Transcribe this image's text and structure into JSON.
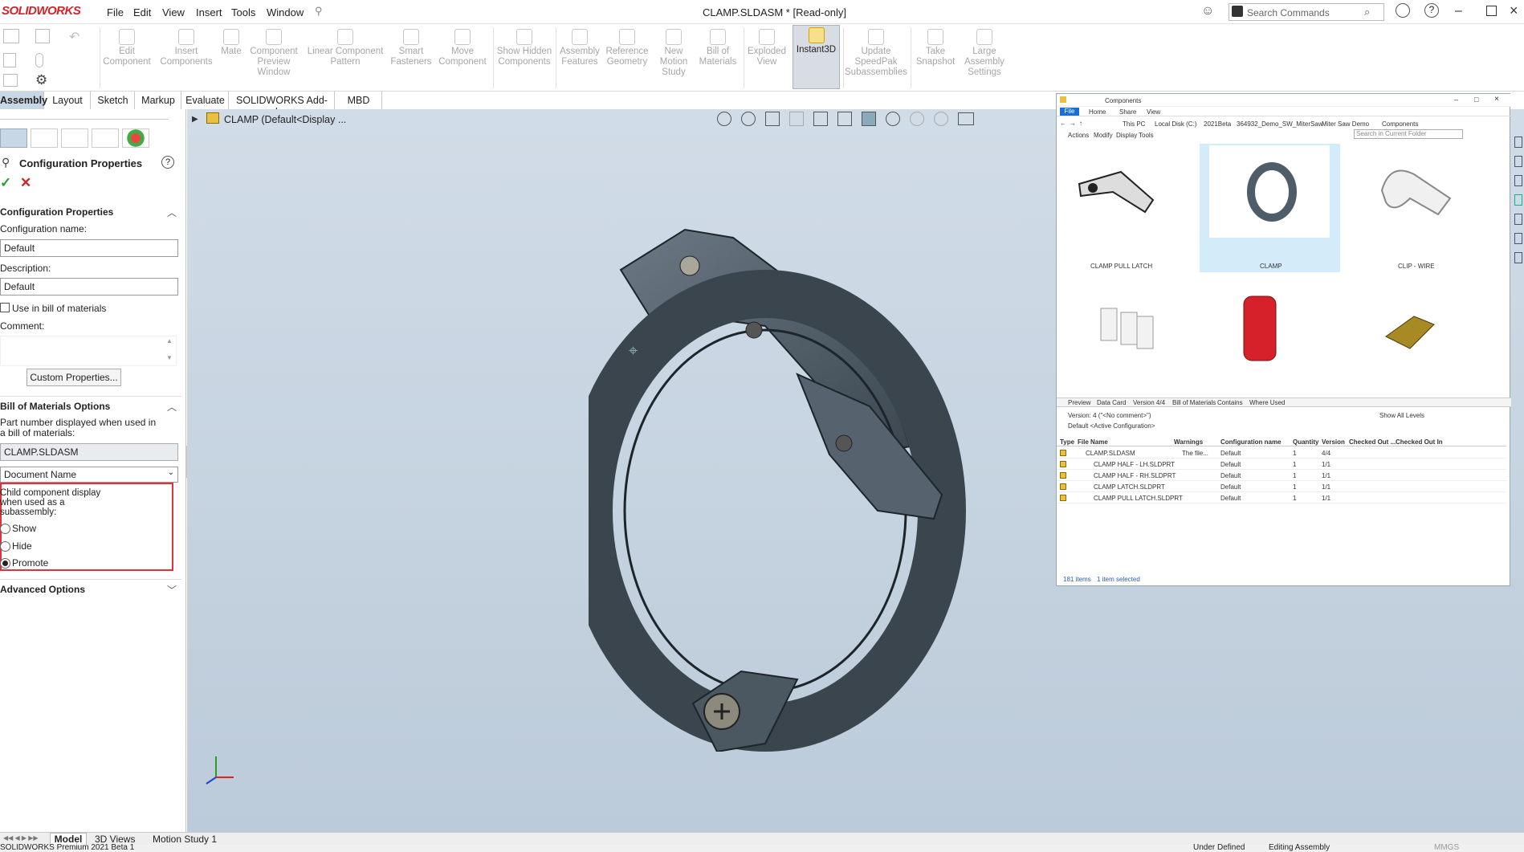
{
  "app": {
    "logo_text": "SOLIDWORKS",
    "title": "CLAMP.SLDASM * [Read-only]"
  },
  "menu": [
    "File",
    "Edit",
    "View",
    "Insert",
    "Tools",
    "Window"
  ],
  "search": {
    "placeholder": "Search Commands"
  },
  "commands": [
    {
      "label": "Edit Component"
    },
    {
      "label": "Insert Components"
    },
    {
      "label": "Mate"
    },
    {
      "label": "Component Preview Window"
    },
    {
      "label": "Linear Component Pattern"
    },
    {
      "label": "Smart Fasteners"
    },
    {
      "label": "Move Component"
    },
    {
      "label": "Show Hidden Components"
    },
    {
      "label": "Assembly Features"
    },
    {
      "label": "Reference Geometry"
    },
    {
      "label": "New Motion Study"
    },
    {
      "label": "Bill of Materials"
    },
    {
      "label": "Exploded View"
    },
    {
      "label": "Instant3D"
    },
    {
      "label": "Update SpeedPak Subassemblies"
    },
    {
      "label": "Take Snapshot"
    },
    {
      "label": "Large Assembly Settings"
    }
  ],
  "tabs": [
    "Assembly",
    "Layout",
    "Sketch",
    "Markup",
    "Evaluate",
    "SOLIDWORKS Add-Ins",
    "MBD"
  ],
  "tree": {
    "root": "CLAMP  (Default<Display ..."
  },
  "config_panel": {
    "title": "Configuration Properties",
    "section1": "Configuration Properties",
    "name_label": "Configuration name:",
    "name_value": "Default",
    "desc_label": "Description:",
    "desc_value": "Default",
    "use_in_bom": "Use in bill of materials",
    "comment_label": "Comment:",
    "custom_btn": "Custom Properties...",
    "section2": "Bill of Materials Options",
    "part_number_label": "Part number displayed when used in a bill of materials:",
    "part_number_value": "CLAMP.SLDASM",
    "part_number_source": "Document Name",
    "child_display_label": "Child component display when used as a subassembly:",
    "opt_show": "Show",
    "opt_hide": "Hide",
    "opt_promote": "Promote",
    "selected_option": "Promote",
    "section3": "Advanced Options"
  },
  "explorer": {
    "window_title": "Components",
    "ribbon_tabs": [
      "File",
      "Home",
      "Share",
      "View"
    ],
    "path": [
      "This PC",
      "Local Disk (C:)",
      "2021Beta",
      "364932_Demo_SW_MiterSaw",
      "Miter Saw Demo",
      "Components"
    ],
    "search_placeholder": "Search in Current Folder",
    "toolbar": [
      "Actions",
      "Modify",
      "Display",
      "Tools"
    ],
    "thumbs": [
      "CLAMP PULL LATCH",
      "CLAMP",
      "CLIP - WIRE"
    ],
    "pane_tabs": [
      "Preview",
      "Data Card",
      "Version 4/4",
      "Bill of Materials",
      "Contains",
      "Where Used"
    ],
    "version_label": "Version: 4 (\"<No comment>\")",
    "config_label": "Default <Active Configuration>",
    "show_levels": "Show All Levels",
    "columns": [
      "Type",
      "File Name",
      "Warnings",
      "Configuration name",
      "Quantity",
      "Version",
      "Checked Out ...",
      "Checked Out In"
    ],
    "rows": [
      {
        "name": "CLAMP.SLDASM",
        "warning": "The file...",
        "config": "Default",
        "qty": "1",
        "ver": "4/4"
      },
      {
        "name": "CLAMP HALF - LH.SLDPRT",
        "warning": "",
        "config": "Default",
        "qty": "1",
        "ver": "1/1"
      },
      {
        "name": "CLAMP HALF - RH.SLDPRT",
        "warning": "",
        "config": "Default",
        "qty": "1",
        "ver": "1/1"
      },
      {
        "name": "CLAMP LATCH.SLDPRT",
        "warning": "",
        "config": "Default",
        "qty": "1",
        "ver": "1/1"
      },
      {
        "name": "CLAMP PULL LATCH.SLDPRT",
        "warning": "",
        "config": "Default",
        "qty": "1",
        "ver": "1/1"
      }
    ],
    "status_items": "181 items",
    "status_selected": "1 item selected"
  },
  "bottom_tabs": [
    "Model",
    "3D Views",
    "Motion Study 1"
  ],
  "status": {
    "left": "SOLIDWORKS Premium 2021 Beta 1",
    "under_defined": "Under Defined",
    "editing": "Editing Assembly",
    "units": "MMGS"
  },
  "colors": {
    "accent": "#d2232a",
    "selection": "#c8d7e6",
    "highlight_box": "#e0323c",
    "part": "#4f5d68"
  }
}
